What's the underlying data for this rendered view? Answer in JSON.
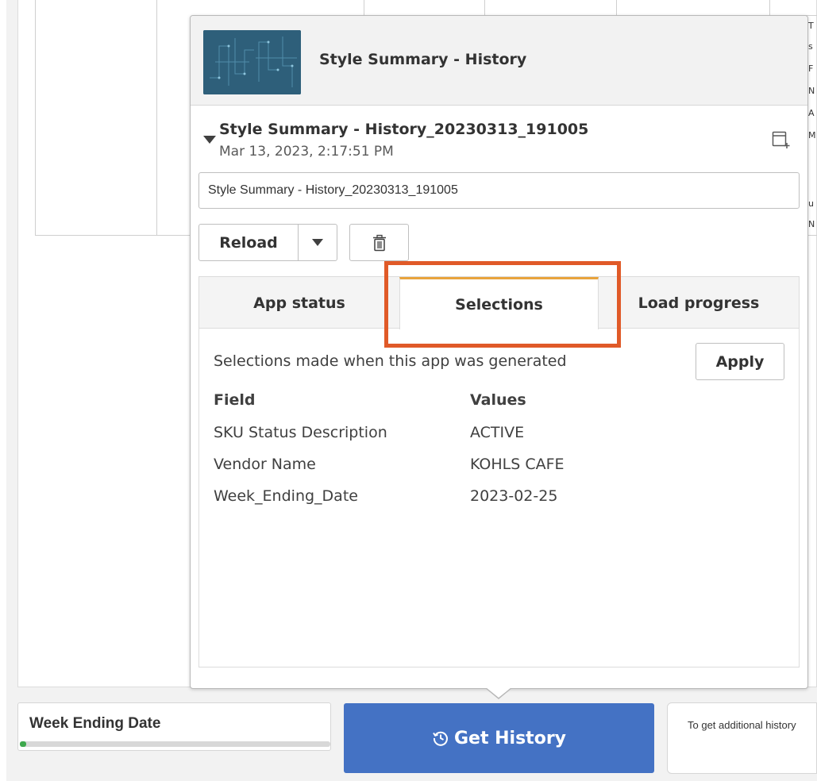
{
  "background": {
    "clipped_letters": [
      "T",
      "s",
      "F",
      "N",
      "A",
      "M",
      "",
      "u",
      "N"
    ]
  },
  "popup": {
    "app_title": "Style Summary - History",
    "version": {
      "name": "Style Summary - History_20230313_191005",
      "date": "Mar 13, 2023, 2:17:51 PM",
      "name_input_value": "Style Summary - History_20230313_191005"
    },
    "actions": {
      "reload_label": "Reload"
    },
    "tabs": [
      {
        "label": "App status",
        "selected": false
      },
      {
        "label": "Selections",
        "selected": true
      },
      {
        "label": "Load progress",
        "selected": false
      }
    ],
    "selections": {
      "caption": "Selections made when this app was generated",
      "apply_label": "Apply",
      "field_header": "Field",
      "values_header": "Values",
      "rows": [
        {
          "field": "SKU Status Description",
          "value": "ACTIVE"
        },
        {
          "field": "Vendor Name",
          "value": "KOHLS CAFE"
        },
        {
          "field": "Week_Ending_Date",
          "value": "2023-02-25"
        }
      ]
    }
  },
  "bottom": {
    "week_card": {
      "title": "Week Ending Date",
      "progress_fraction": 0.02
    },
    "history_button": {
      "label": "Get History",
      "icon": "history-clock-icon"
    },
    "info_text": "To get additional history"
  },
  "colors": {
    "history_button": "#4472c4",
    "highlight": "#e05a28",
    "active_tab_accent": "#e8a33d",
    "progress_fill": "#3ea84d"
  }
}
